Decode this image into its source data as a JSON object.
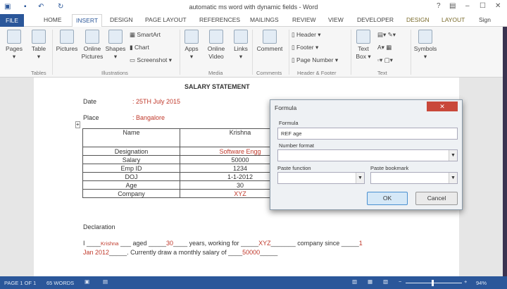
{
  "window": {
    "title": "automatic ms word with dynamic fields - Word",
    "help": "?",
    "minimize": "–",
    "maximize": "☐",
    "close": "✕"
  },
  "quick_access": {
    "save_icon": "save-icon",
    "undo_icon": "undo-icon",
    "redo_icon": "redo-icon"
  },
  "tabs": [
    {
      "label": "FILE"
    },
    {
      "label": "HOME"
    },
    {
      "label": "INSERT"
    },
    {
      "label": "DESIGN"
    },
    {
      "label": "PAGE LAYOUT"
    },
    {
      "label": "REFERENCES"
    },
    {
      "label": "MAILINGS"
    },
    {
      "label": "REVIEW"
    },
    {
      "label": "VIEW"
    },
    {
      "label": "DEVELOPER"
    },
    {
      "label": "DESIGN"
    },
    {
      "label": "LAYOUT"
    },
    {
      "label": "Sign"
    }
  ],
  "ribbon": {
    "pages": "Pages",
    "table": "Table",
    "pictures": "Pictures",
    "online_pictures": "Online Pictures",
    "shapes": "Shapes",
    "smartart": "SmartArt",
    "chart": "Chart",
    "screenshot": "Screenshot",
    "apps": "Apps",
    "online_video": "Online Video",
    "links": "Links",
    "comment": "Comment",
    "header": "Header",
    "footer": "Footer",
    "page_number": "Page Number",
    "text_box": "Text Box",
    "symbols": "Symbols",
    "groups": {
      "tables": "Tables",
      "illustrations": "Illustrations",
      "media": "Media",
      "comments": "Comments",
      "header_footer": "Header & Footer",
      "text": "Text"
    }
  },
  "document": {
    "heading": "SALARY STATEMENT",
    "date_label": "Date",
    "date_value": ": 25TH July 2015",
    "place_label": "Place",
    "place_value": ": Bangalore",
    "table": [
      [
        "Name",
        "Krishna"
      ],
      [
        "Designation",
        "Software Engg"
      ],
      [
        "Salary",
        "50000"
      ],
      [
        "Emp ID",
        "1234"
      ],
      [
        "DOJ",
        "1-1-2012"
      ],
      [
        "Age",
        "30"
      ],
      [
        "Company",
        "XYZ"
      ]
    ],
    "declaration_title": "Declaration",
    "decl": {
      "p1": "I ____",
      "name": "Krishna",
      "p2": " ___ aged _____",
      "age": "30",
      "p3": "____ years, working for _____",
      "company": "XYZ",
      "p4": "_______ company since _____",
      "doj1": "1",
      "doj2": "Jan 2012",
      "p5": "_____. Currently draw a monthly salary of ____",
      "salary": "50000",
      "p6": "_____"
    }
  },
  "dialog": {
    "title": "Formula",
    "formula_label": "Formula",
    "formula_value": "REF age",
    "number_format_label": "Number format",
    "number_format_value": "",
    "paste_function_label": "Paste function",
    "paste_function_value": "",
    "paste_bookmark_label": "Paste bookmark",
    "paste_bookmark_value": "",
    "ok": "OK",
    "cancel": "Cancel",
    "close": "✕"
  },
  "status": {
    "page": "PAGE 1 OF 1",
    "words": "65 WORDS",
    "zoom": "94%",
    "zoom_percent": 94
  }
}
